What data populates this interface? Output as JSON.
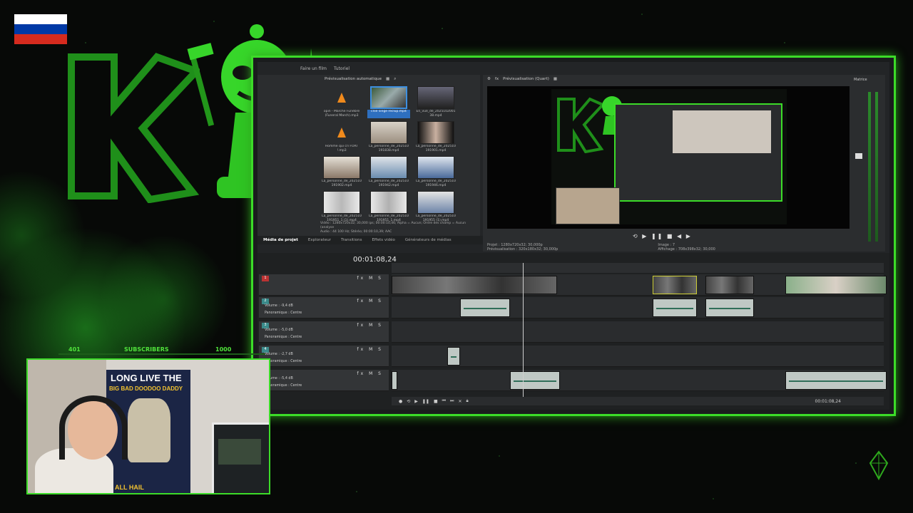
{
  "overlay": {
    "subscribers_current": "401",
    "subscribers_label": "SUBSCRIBERS",
    "subscribers_goal": "1000",
    "flag_colors": [
      "#ffffff",
      "#0039a6",
      "#d52b1e"
    ],
    "accent": "#3cdc28"
  },
  "app": {
    "menu": {
      "make_movie": "Faire un film",
      "tutorial": "Tutoriel"
    },
    "media_panel": {
      "toolbar_label": "Prévisualisation automatique",
      "items": [
        {
          "caption": "opin - Marche Funèbre (Funeral March).mp3",
          "kind": "audio"
        },
        {
          "caption": "cnie singe reclup.mp4",
          "kind": "video",
          "selected": true
        },
        {
          "caption": "En_vue_de_2025102001 38.mp4",
          "kind": "video"
        },
        {
          "caption": "Homme qui cri FORT !.mp3",
          "kind": "audio"
        },
        {
          "caption": "La_personne_de_202510 191838.mp4",
          "kind": "video"
        },
        {
          "caption": "La_personne_de_202510 191901.mp4",
          "kind": "video"
        },
        {
          "caption": "La_personne_de_202510 191902.mp4",
          "kind": "video"
        },
        {
          "caption": "La_personne_de_202510 191942.mp4",
          "kind": "video"
        },
        {
          "caption": "La_personne_de_202510 191946.mp4",
          "kind": "video"
        },
        {
          "caption": "La_personne_de_202510 191951_1 (1).mp4",
          "kind": "video"
        },
        {
          "caption": "La_personne_de_202510 191951_1.mp4",
          "kind": "video"
        },
        {
          "caption": "La_personne_de_202510 191955 (1).mp4",
          "kind": "video"
        }
      ],
      "info_line1": "Vidéo : 1280x720x32; 30,000 ips; 00:00:10,46; Alpha = Aucun; Ordre des champ = Aucun (analyse",
      "info_line2": "Audio : 44 100 Hz; Stéréo; 00:00:10,39; AAC"
    },
    "panel_tabs": [
      "Média de projet",
      "Explorateur",
      "Transitions",
      "Effets vidéo",
      "Générateurs de médias"
    ],
    "preview": {
      "toolbar_label": "Prévisualisation (Quart)",
      "project_label": "Projet :",
      "project_value": "1280x720x32; 30,000p",
      "previs_label": "Prévisualisation :",
      "previs_value": "320x180x32; 30,000p",
      "image_label": "Image :",
      "image_value": "7",
      "display_label": "Affichage :",
      "display_value": "708x398x32; 30,000"
    },
    "master": {
      "label": "Matrice"
    },
    "timeline": {
      "timecode": "00:01:08,24",
      "bottom_timecode": "00:01:08,24",
      "tracks": [
        {
          "num": "1",
          "type": "video",
          "level": "",
          "pan": ""
        },
        {
          "num": "2",
          "type": "audio",
          "volume_label": "Volume :",
          "level": "-9,4 dB",
          "pan_label": "Panoramique :",
          "pan": "Centre"
        },
        {
          "num": "3",
          "type": "audio",
          "volume_label": "Volume :",
          "level": "-5,0 dB",
          "pan_label": "Panoramique :",
          "pan": "Centre"
        },
        {
          "num": "4",
          "type": "audio",
          "volume_label": "Volume :",
          "level": "-2,7 dB",
          "pan_label": "Panoramique :",
          "pan": "Centre"
        },
        {
          "num": "5",
          "type": "audio",
          "volume_label": "Volume :",
          "level": "-5,4 dB",
          "pan_label": "Panoramique :",
          "pan": "Centre"
        }
      ]
    }
  },
  "webcam": {
    "poster_line1": "LONG LIVE THE",
    "poster_line2": "BIG BAD DOODOO DADDY",
    "poster_line3": "ALL HAIL"
  }
}
